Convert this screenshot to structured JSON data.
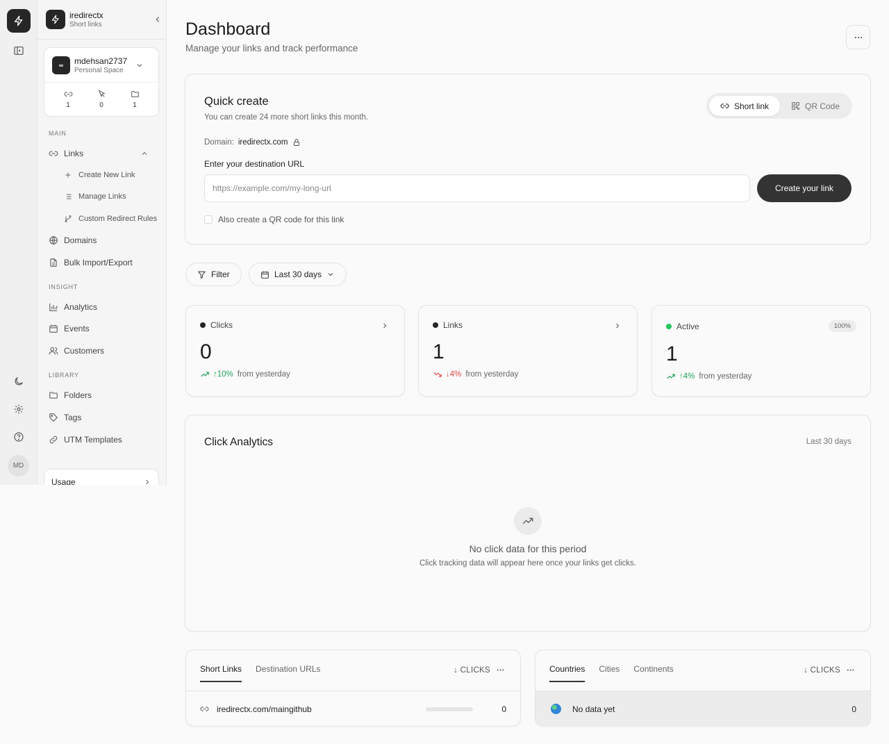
{
  "rail": {
    "avatar_initials": "MD"
  },
  "brand": {
    "name": "iredirectx",
    "subtitle": "Short links"
  },
  "workspace": {
    "avatar": "∞",
    "name": "mdehsan2737",
    "type": "Personal Space",
    "stats": [
      {
        "icon": "link-icon",
        "value": "1"
      },
      {
        "icon": "cursor-click-icon",
        "value": "0"
      },
      {
        "icon": "folder-icon",
        "value": "1"
      }
    ]
  },
  "sidebar": {
    "sections": {
      "main": "MAIN",
      "insight": "INSIGHT",
      "library": "LIBRARY"
    },
    "links": "Links",
    "link_children": [
      "Create New Link",
      "Manage Links",
      "Custom Redirect Rules"
    ],
    "domains": "Domains",
    "bulk": "Bulk Import/Export",
    "analytics": "Analytics",
    "events": "Events",
    "customers": "Customers",
    "folders": "Folders",
    "tags": "Tags",
    "utm": "UTM Templates",
    "usage": "Usage"
  },
  "header": {
    "title": "Dashboard",
    "subtitle": "Manage your links and track performance"
  },
  "quick_create": {
    "title": "Quick create",
    "subtitle": "You can create 24 more short links this month.",
    "toggle": {
      "short_link": "Short link",
      "qr_code": "QR Code",
      "selected": "Short link"
    },
    "domain_label": "Domain:",
    "domain_value": "iredirectx.com",
    "url_label": "Enter your destination URL",
    "url_placeholder": "https://example.com/my-long-url",
    "url_value": "",
    "create_button": "Create your link",
    "qr_checkbox_label": "Also create a QR code for this link",
    "qr_checkbox_checked": false
  },
  "filters": {
    "filter_label": "Filter",
    "date_range": "Last 30 days"
  },
  "stats": {
    "clicks": {
      "label": "Clicks",
      "value": "0",
      "trend_pct": "10%",
      "trend_dir": "up",
      "trend_text": "from yesterday",
      "dot_color": "#262626"
    },
    "links": {
      "label": "Links",
      "value": "1",
      "trend_pct": "4%",
      "trend_dir": "down",
      "trend_text": "from yesterday",
      "dot_color": "#262626"
    },
    "active": {
      "label": "Active",
      "value": "1",
      "badge": "100%",
      "trend_pct": "4%",
      "trend_dir": "up",
      "trend_text": "from yesterday",
      "dot_color": "#22c55e"
    }
  },
  "click_analytics": {
    "title": "Click Analytics",
    "period": "Last 30 days",
    "empty_title": "No click data for this period",
    "empty_subtitle": "Click tracking data will appear here once your links get clicks."
  },
  "links_table": {
    "tabs": [
      "Short Links",
      "Destination URLs"
    ],
    "active_tab": "Short Links",
    "sort_label": "↓ CLICKS",
    "rows": [
      {
        "url": "iredirectx.com/maingithub",
        "clicks": "0"
      }
    ]
  },
  "geo_table": {
    "tabs": [
      "Countries",
      "Cities",
      "Continents"
    ],
    "active_tab": "Countries",
    "sort_label": "↓ CLICKS",
    "rows": [
      {
        "label": "No data yet",
        "clicks": "0"
      }
    ]
  },
  "colors": {
    "accent_dark": "#262626",
    "trend_up": "#22a35a",
    "trend_down": "#e04747",
    "active_dot": "#22c55e"
  }
}
